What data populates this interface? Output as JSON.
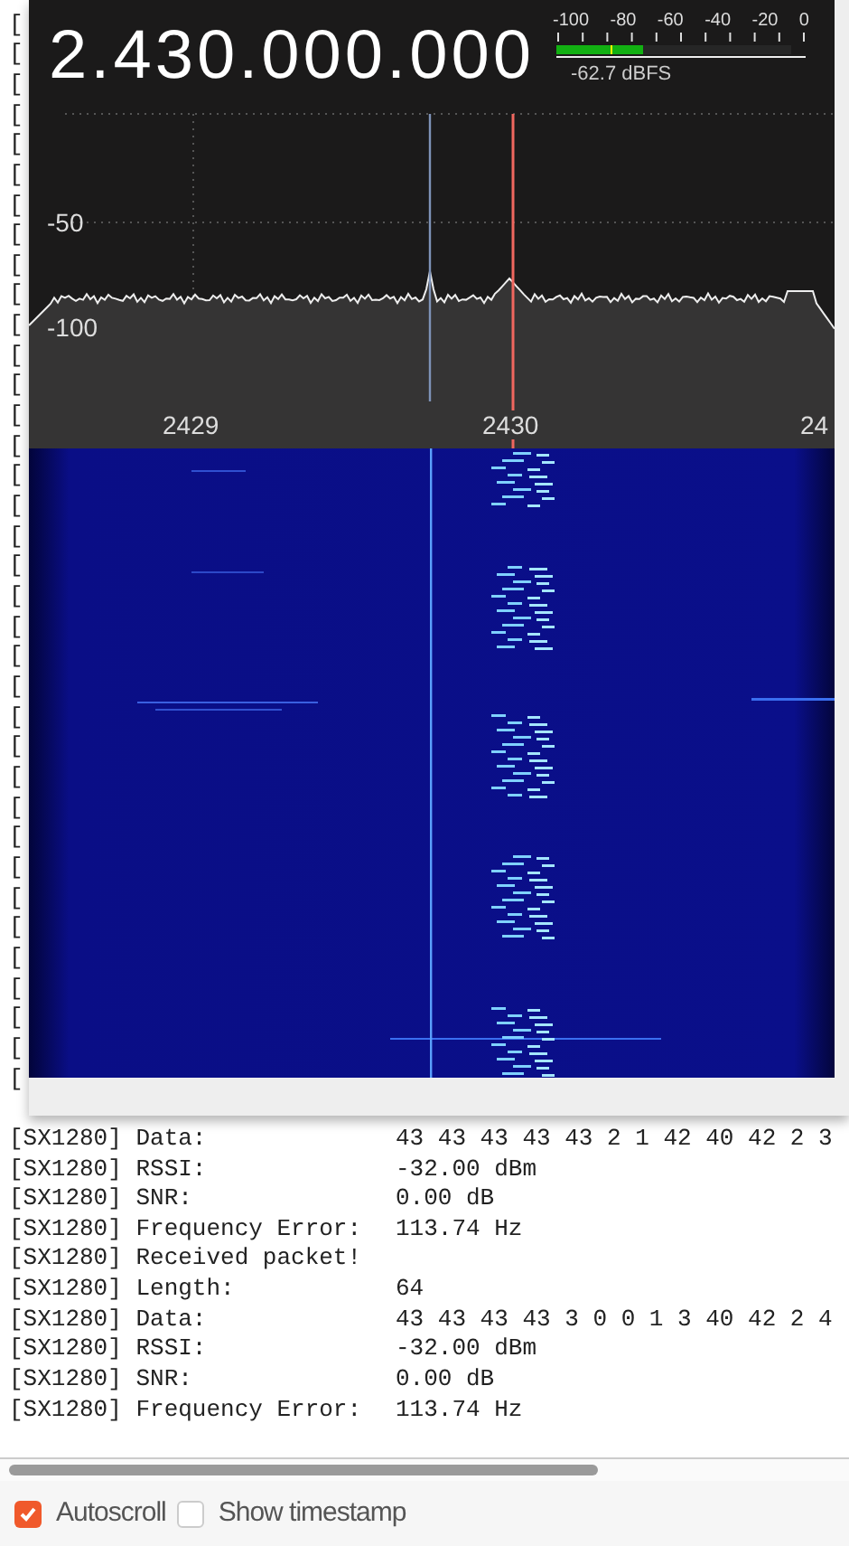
{
  "serial_log": {
    "covered_lines": [
      "[",
      "[",
      "[",
      "[",
      "[",
      "[",
      "[",
      "[",
      "[",
      "[",
      "[",
      "[",
      "[",
      "[",
      "[",
      "[",
      "[",
      "[",
      "[",
      "[",
      "[",
      "[",
      "[",
      "[",
      "[",
      "[",
      "[",
      "[",
      "[",
      "[",
      "[",
      "[",
      "[",
      "[",
      "[",
      "["
    ],
    "lines": [
      {
        "label": "[SX1280] Data:",
        "value": "43 43 43 43 43 2 1 42 40 42 2 3"
      },
      {
        "label": "[SX1280] RSSI:",
        "value": "-32.00 dBm"
      },
      {
        "label": "[SX1280] SNR:",
        "value": "0.00 dB"
      },
      {
        "label": "[SX1280] Frequency Error:",
        "value": "113.74 Hz"
      },
      {
        "label": "[SX1280] Received packet!"
      },
      {
        "label": "[SX1280] Length:",
        "value": "64"
      },
      {
        "label": "[SX1280] Data:",
        "value": "43 43 43 43 3 0 0 1 3 40 42 2 4"
      },
      {
        "label": "[SX1280] RSSI:",
        "value": "-32.00 dBm"
      },
      {
        "label": "[SX1280] SNR:",
        "value": "0.00 dB"
      },
      {
        "label": "[SX1280] Frequency Error:",
        "value": "113.74 Hz"
      }
    ]
  },
  "sdr_window": {
    "frequency": "2.430.000.000",
    "meter": {
      "scale": [
        "-100",
        "-80",
        "-60",
        "-40",
        "-20",
        "0"
      ],
      "level": 0.37,
      "reading": "-62.7 dBFS"
    },
    "y_labels": [
      "-50",
      "-100"
    ],
    "x_labels": [
      "2429",
      "2430",
      "24"
    ]
  },
  "footer": {
    "options": [
      {
        "label": "Autoscroll",
        "checked": true
      },
      {
        "label": "Show timestamp",
        "checked": false
      }
    ]
  }
}
